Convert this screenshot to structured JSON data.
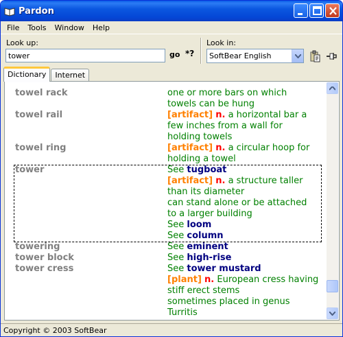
{
  "window": {
    "title": "Pardon"
  },
  "menu": [
    {
      "label": "File"
    },
    {
      "label": "Tools"
    },
    {
      "label": "Window"
    },
    {
      "label": "Help"
    }
  ],
  "lookup": {
    "label": "Look up:",
    "value": "tower",
    "go_label": "go",
    "wildcard_label": "*?"
  },
  "lookin": {
    "label": "Look in:",
    "selected": "SoftBear English"
  },
  "tabs": [
    {
      "label": "Dictionary",
      "active": true
    },
    {
      "label": "Internet",
      "active": false
    }
  ],
  "entries": [
    {
      "term": "towel rack",
      "lines": [
        [
          [
            "g",
            "one or more bars on which"
          ]
        ],
        [
          [
            "g",
            "towels can be hung"
          ]
        ]
      ]
    },
    {
      "term": "towel rail",
      "lines": [
        [
          [
            "o",
            "[artifact]"
          ],
          [
            "g",
            " "
          ],
          [
            "r",
            "n."
          ],
          [
            "g",
            " a horizontal bar a"
          ]
        ],
        [
          [
            "g",
            "few inches from a wall for"
          ]
        ],
        [
          [
            "g",
            "holding towels"
          ]
        ]
      ]
    },
    {
      "term": "towel ring",
      "lines": [
        [
          [
            "o",
            "[artifact]"
          ],
          [
            "g",
            " "
          ],
          [
            "r",
            "n."
          ],
          [
            "g",
            " a circular hoop for"
          ]
        ],
        [
          [
            "g",
            "holding a towel"
          ]
        ]
      ]
    },
    {
      "term": "tower",
      "lines": [
        [
          [
            "g",
            "See "
          ],
          [
            "b",
            "tugboat"
          ]
        ],
        [
          [
            "o",
            "[artifact]"
          ],
          [
            "g",
            " "
          ],
          [
            "r",
            "n."
          ],
          [
            "g",
            " a structure taller"
          ]
        ],
        [
          [
            "g",
            "than its diameter"
          ]
        ],
        [
          [
            "g",
            "can stand alone or be attached"
          ]
        ],
        [
          [
            "g",
            "to a larger building"
          ]
        ],
        [
          [
            "g",
            "See "
          ],
          [
            "b",
            "loom"
          ]
        ],
        [
          [
            "g",
            "See "
          ],
          [
            "b",
            "column"
          ]
        ]
      ]
    },
    {
      "term": "towering",
      "lines": [
        [
          [
            "g",
            "See "
          ],
          [
            "b",
            "eminent"
          ]
        ]
      ]
    },
    {
      "term": "tower block",
      "lines": [
        [
          [
            "g",
            "See "
          ],
          [
            "b",
            "high-rise"
          ]
        ]
      ]
    },
    {
      "term": "tower cress",
      "lines": [
        [
          [
            "g",
            "See "
          ],
          [
            "b",
            "tower mustard"
          ]
        ],
        [
          [
            "o",
            "[plant]"
          ],
          [
            "g",
            " "
          ],
          [
            "r",
            "n."
          ],
          [
            "g",
            " European cress having"
          ]
        ],
        [
          [
            "g",
            "stiff erect stems"
          ]
        ],
        [
          [
            "g",
            "sometimes placed in genus"
          ]
        ],
        [
          [
            "g",
            "Turritis"
          ]
        ]
      ]
    }
  ],
  "status": {
    "text": "Copyright © 2003 SoftBear"
  },
  "colors": {
    "term": "#808080",
    "definition": "#008000",
    "category": "#ff8000",
    "pos": "#ff0000",
    "link": "#000080"
  }
}
